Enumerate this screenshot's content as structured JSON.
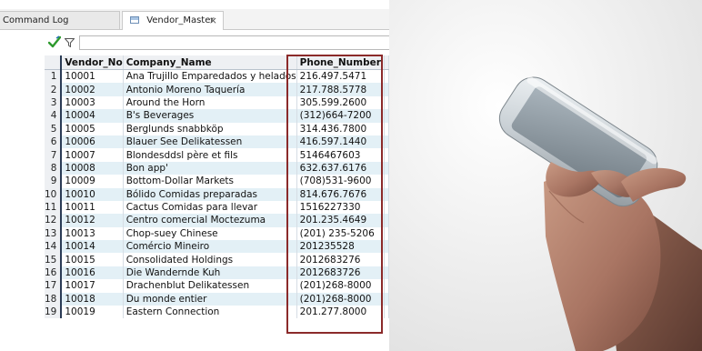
{
  "tabs": [
    {
      "label": "Command Log"
    },
    {
      "label": "Vendor_Master",
      "close": "×"
    }
  ],
  "filter": {
    "value": "",
    "placeholder": ""
  },
  "grid": {
    "columns": [
      "Vendor_No",
      "Company_Name",
      "Phone_Number"
    ],
    "rows": [
      {
        "n": "1",
        "vendor_no": "10001",
        "company": "Ana Trujillo Emparedados y helados",
        "phone": "216.497.5471"
      },
      {
        "n": "2",
        "vendor_no": "10002",
        "company": "Antonio Moreno Taquería",
        "phone": "217.788.5778"
      },
      {
        "n": "3",
        "vendor_no": "10003",
        "company": "Around the Horn",
        "phone": "305.599.2600"
      },
      {
        "n": "4",
        "vendor_no": "10004",
        "company": "B's Beverages",
        "phone": "(312)664-7200"
      },
      {
        "n": "5",
        "vendor_no": "10005",
        "company": "Berglunds snabbköp",
        "phone": "314.436.7800"
      },
      {
        "n": "6",
        "vendor_no": "10006",
        "company": "Blauer See Delikatessen",
        "phone": "416.597.1440"
      },
      {
        "n": "7",
        "vendor_no": "10007",
        "company": "Blondesddsl père et fils",
        "phone": "5146467603"
      },
      {
        "n": "8",
        "vendor_no": "10008",
        "company": "Bon app'",
        "phone": "632.637.6176"
      },
      {
        "n": "9",
        "vendor_no": "10009",
        "company": "Bottom-Dollar Markets",
        "phone": "(708)531-9600"
      },
      {
        "n": "10",
        "vendor_no": "10010",
        "company": "Bólido Comidas preparadas",
        "phone": "814.676.7676"
      },
      {
        "n": "11",
        "vendor_no": "10011",
        "company": "Cactus Comidas para llevar",
        "phone": "1516227330"
      },
      {
        "n": "12",
        "vendor_no": "10012",
        "company": "Centro comercial Moctezuma",
        "phone": "201.235.4649"
      },
      {
        "n": "13",
        "vendor_no": "10013",
        "company": "Chop-suey Chinese",
        "phone": "(201) 235-5206"
      },
      {
        "n": "14",
        "vendor_no": "10014",
        "company": "Comércio Mineiro",
        "phone": "201235528"
      },
      {
        "n": "15",
        "vendor_no": "10015",
        "company": "Consolidated Holdings",
        "phone": "2012683276"
      },
      {
        "n": "16",
        "vendor_no": "10016",
        "company": "Die Wandernde Kuh",
        "phone": "2012683726"
      },
      {
        "n": "17",
        "vendor_no": "10017",
        "company": "Drachenblut Delikatessen",
        "phone": "(201)268-8000"
      },
      {
        "n": "18",
        "vendor_no": "10018",
        "company": "Du monde entier",
        "phone": "(201)268-8000"
      },
      {
        "n": "19",
        "vendor_no": "10019",
        "company": "Eastern Connection",
        "phone": "201.277.8000"
      }
    ]
  },
  "colors": {
    "row_stripe": "#e3f0f6",
    "highlight_border": "#8b2a2a",
    "apply_check": "#2e9a2e"
  },
  "icons": {
    "tab": "table-icon",
    "apply": "checkmark-filter-icon",
    "filter": "funnel-icon",
    "close": "close-icon"
  }
}
